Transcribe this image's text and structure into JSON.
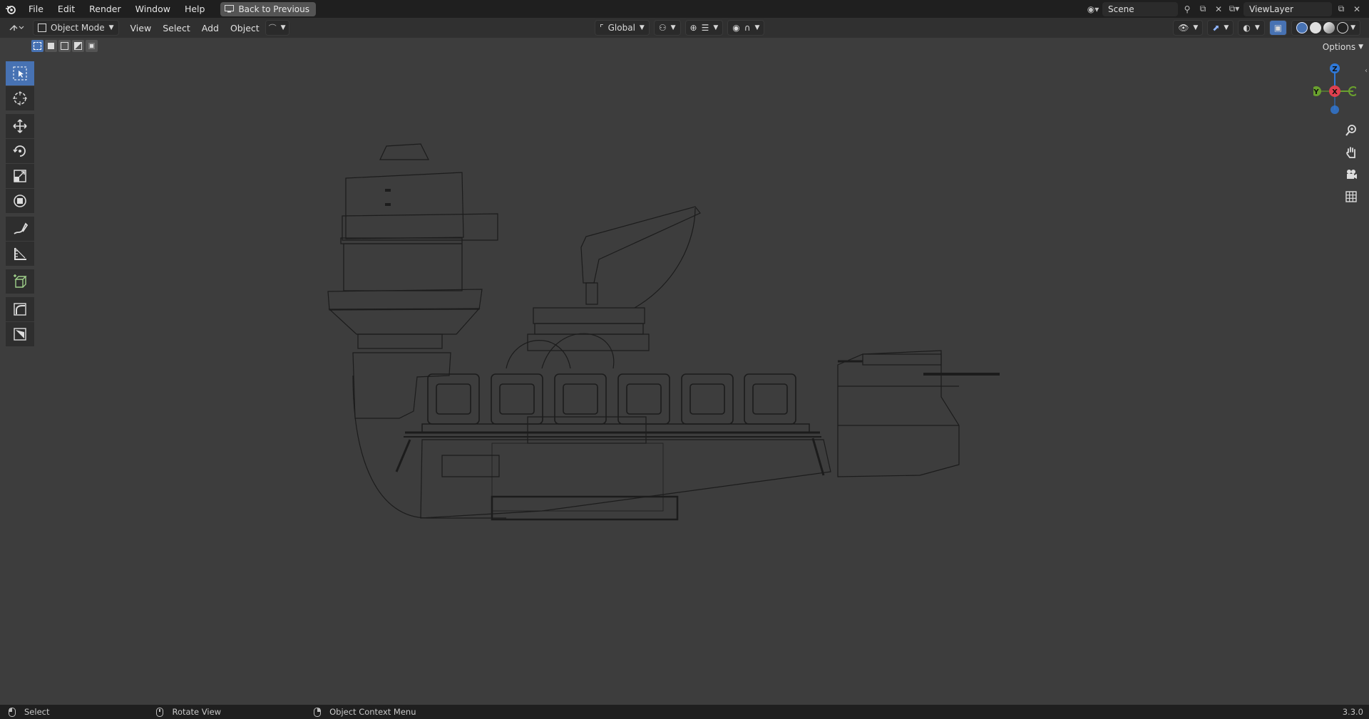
{
  "topbar": {
    "menus": [
      "File",
      "Edit",
      "Render",
      "Window",
      "Help"
    ],
    "back_button": "Back to Previous",
    "scene": "Scene",
    "view_layer": "ViewLayer"
  },
  "header": {
    "mode": "Object Mode",
    "menus": [
      "View",
      "Select",
      "Add",
      "Object"
    ],
    "orientation": "Global"
  },
  "options_label": "Options",
  "tools": [
    {
      "name": "select-box-tool",
      "icon": "select-box-icon"
    },
    {
      "name": "cursor-tool",
      "icon": "cursor-icon"
    },
    {
      "name": "move-tool",
      "icon": "move-icon"
    },
    {
      "name": "rotate-tool",
      "icon": "rotate-icon"
    },
    {
      "name": "scale-tool",
      "icon": "scale-icon"
    },
    {
      "name": "transform-tool",
      "icon": "transform-icon"
    },
    {
      "name": "annotate-tool",
      "icon": "annotate-icon"
    },
    {
      "name": "measure-tool",
      "icon": "measure-icon"
    },
    {
      "name": "add-cube-tool",
      "icon": "add-cube-icon"
    },
    {
      "name": "shear-tool",
      "icon": "shear-icon"
    },
    {
      "name": "rip-tool",
      "icon": "rip-icon"
    }
  ],
  "gizmo": {
    "z": "Z",
    "x": "X",
    "y": "Y"
  },
  "status": {
    "select": "Select",
    "rotate": "Rotate View",
    "context": "Object Context Menu",
    "version": "3.3.0"
  },
  "colors": {
    "accent": "#4772b3",
    "bg": "#3d3d3d",
    "topbar": "#1f1f1f",
    "x_axis": "#e0404f",
    "y_axis": "#6aa12e",
    "z_axis": "#2f79d9"
  }
}
